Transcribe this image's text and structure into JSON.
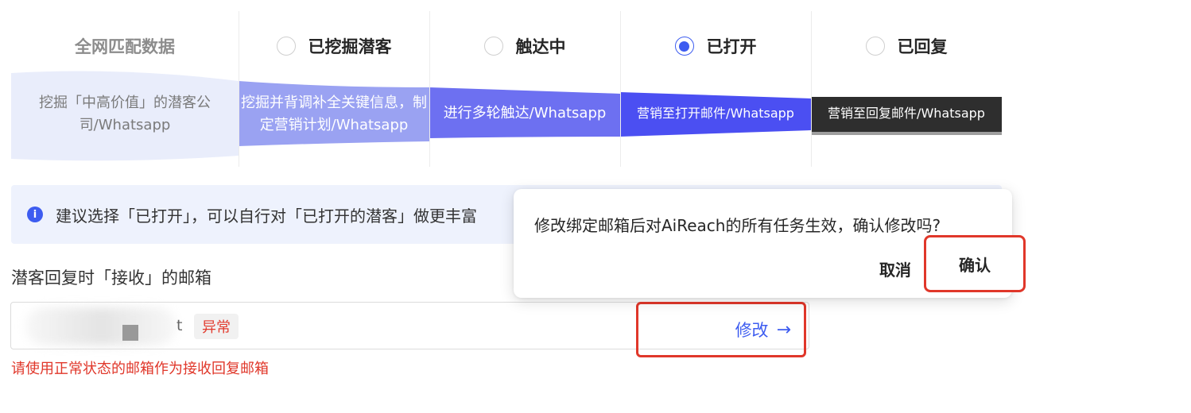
{
  "stages": [
    {
      "title": "全网匹配数据",
      "description": "挖掘「中高价值」的潜客公司/Whatsapp",
      "has_radio": false,
      "checked": false
    },
    {
      "title": "已挖掘潜客",
      "description": "挖掘并背调补全关键信息，制定营销计划/Whatsapp",
      "has_radio": true,
      "checked": false
    },
    {
      "title": "触达中",
      "description": "进行多轮触达/Whatsapp",
      "has_radio": true,
      "checked": false
    },
    {
      "title": "已打开",
      "description": "营销至打开邮件/Whatsapp",
      "has_radio": true,
      "checked": true
    },
    {
      "title": "已回复",
      "description": "营销至回复邮件/Whatsapp",
      "has_radio": true,
      "checked": false
    }
  ],
  "info_banner": {
    "text": "建议选择「已打开」，可以自行对「已打开的潜客」做更丰富"
  },
  "reply_email": {
    "label": "潜客回复时「接收」的邮箱",
    "value_fragment": "t",
    "status_tag": "异常",
    "error_message": "请使用正常状态的邮箱作为接收回复邮箱",
    "modify_label": "修改",
    "modify_arrow": "→"
  },
  "popconfirm": {
    "message": "修改绑定邮箱后对AiReach的所有任务生效，确认修改吗?",
    "cancel_label": "取消",
    "confirm_label": "确认"
  },
  "colors": {
    "primary": "#3d5cf0",
    "error": "#e0372a",
    "band_1": "#e6ebfb",
    "band_2": "#8f9af2",
    "band_3": "#6a6ff0",
    "band_4": "#4a4ff0",
    "band_5": "#2f2f2f"
  },
  "icons": {
    "info": "info-circle-icon",
    "radio": "radio-icon",
    "arrow": "arrow-right-icon"
  }
}
